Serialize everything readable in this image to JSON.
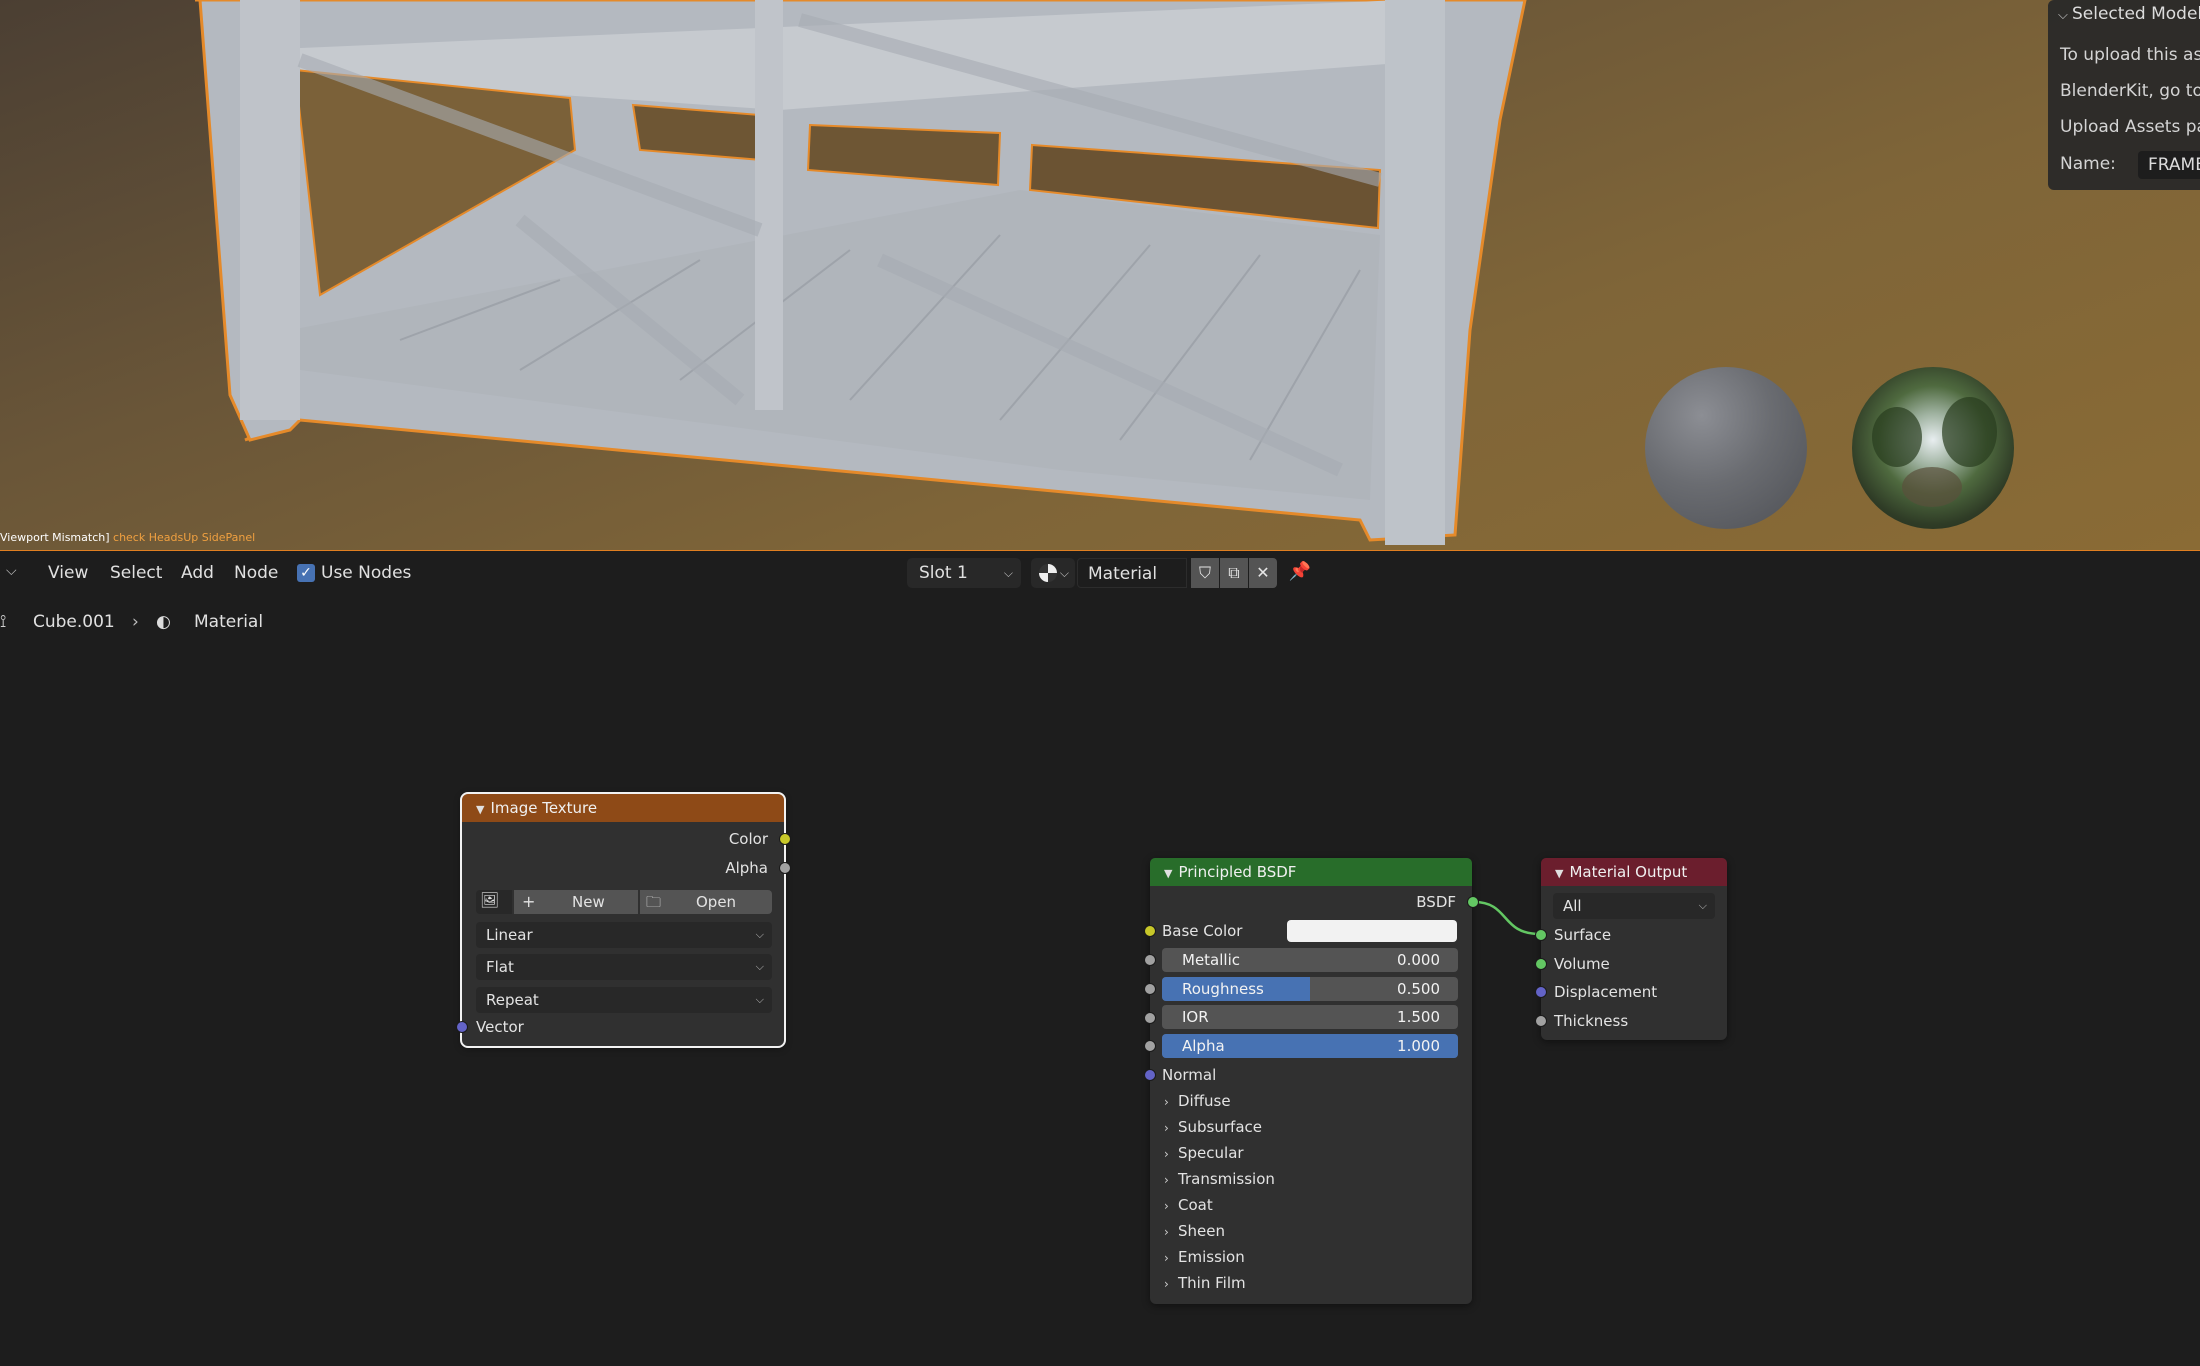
{
  "viewport": {
    "status_prefix": "Viewport Mismatch]",
    "status_hint": "check HeadsUp SidePanel"
  },
  "blenderkit_panel": {
    "header": "Selected Model",
    "lines": [
      "To upload this ass",
      "BlenderKit, go to t",
      "Upload Assets pa"
    ],
    "name_label": "Name:",
    "name_value": "FRAME"
  },
  "node_editor_header": {
    "menus": [
      "View",
      "Select",
      "Add",
      "Node"
    ],
    "use_nodes_label": "Use Nodes",
    "use_nodes_checked": true,
    "slot": "Slot 1",
    "material_name": "Material"
  },
  "breadcrumb": {
    "object": "Cube.001",
    "material": "Material"
  },
  "image_texture_node": {
    "title": "Image Texture",
    "header_color": "#8e4a17",
    "outputs": [
      "Color",
      "Alpha"
    ],
    "new_label": "New",
    "open_label": "Open",
    "interpolation": "Linear",
    "projection": "Flat",
    "extension": "Repeat",
    "input_vector": "Vector"
  },
  "principled_node": {
    "title": "Principled BSDF",
    "header_color": "#286d2a",
    "output": "BSDF",
    "base_color_label": "Base Color",
    "base_color_value": "#f2f2f2",
    "fields": [
      {
        "label": "Metallic",
        "value": "0.000",
        "fill": 0.0
      },
      {
        "label": "Roughness",
        "value": "0.500",
        "fill": 0.5
      },
      {
        "label": "IOR",
        "value": "1.500",
        "fill": 0.0
      },
      {
        "label": "Alpha",
        "value": "1.000",
        "fill": 1.0
      }
    ],
    "normal_label": "Normal",
    "panels": [
      "Diffuse",
      "Subsurface",
      "Specular",
      "Transmission",
      "Coat",
      "Sheen",
      "Emission",
      "Thin Film"
    ]
  },
  "material_output_node": {
    "title": "Material Output",
    "header_color": "#6b1e2d",
    "target": "All",
    "inputs": [
      "Surface",
      "Volume",
      "Displacement",
      "Thickness"
    ]
  }
}
